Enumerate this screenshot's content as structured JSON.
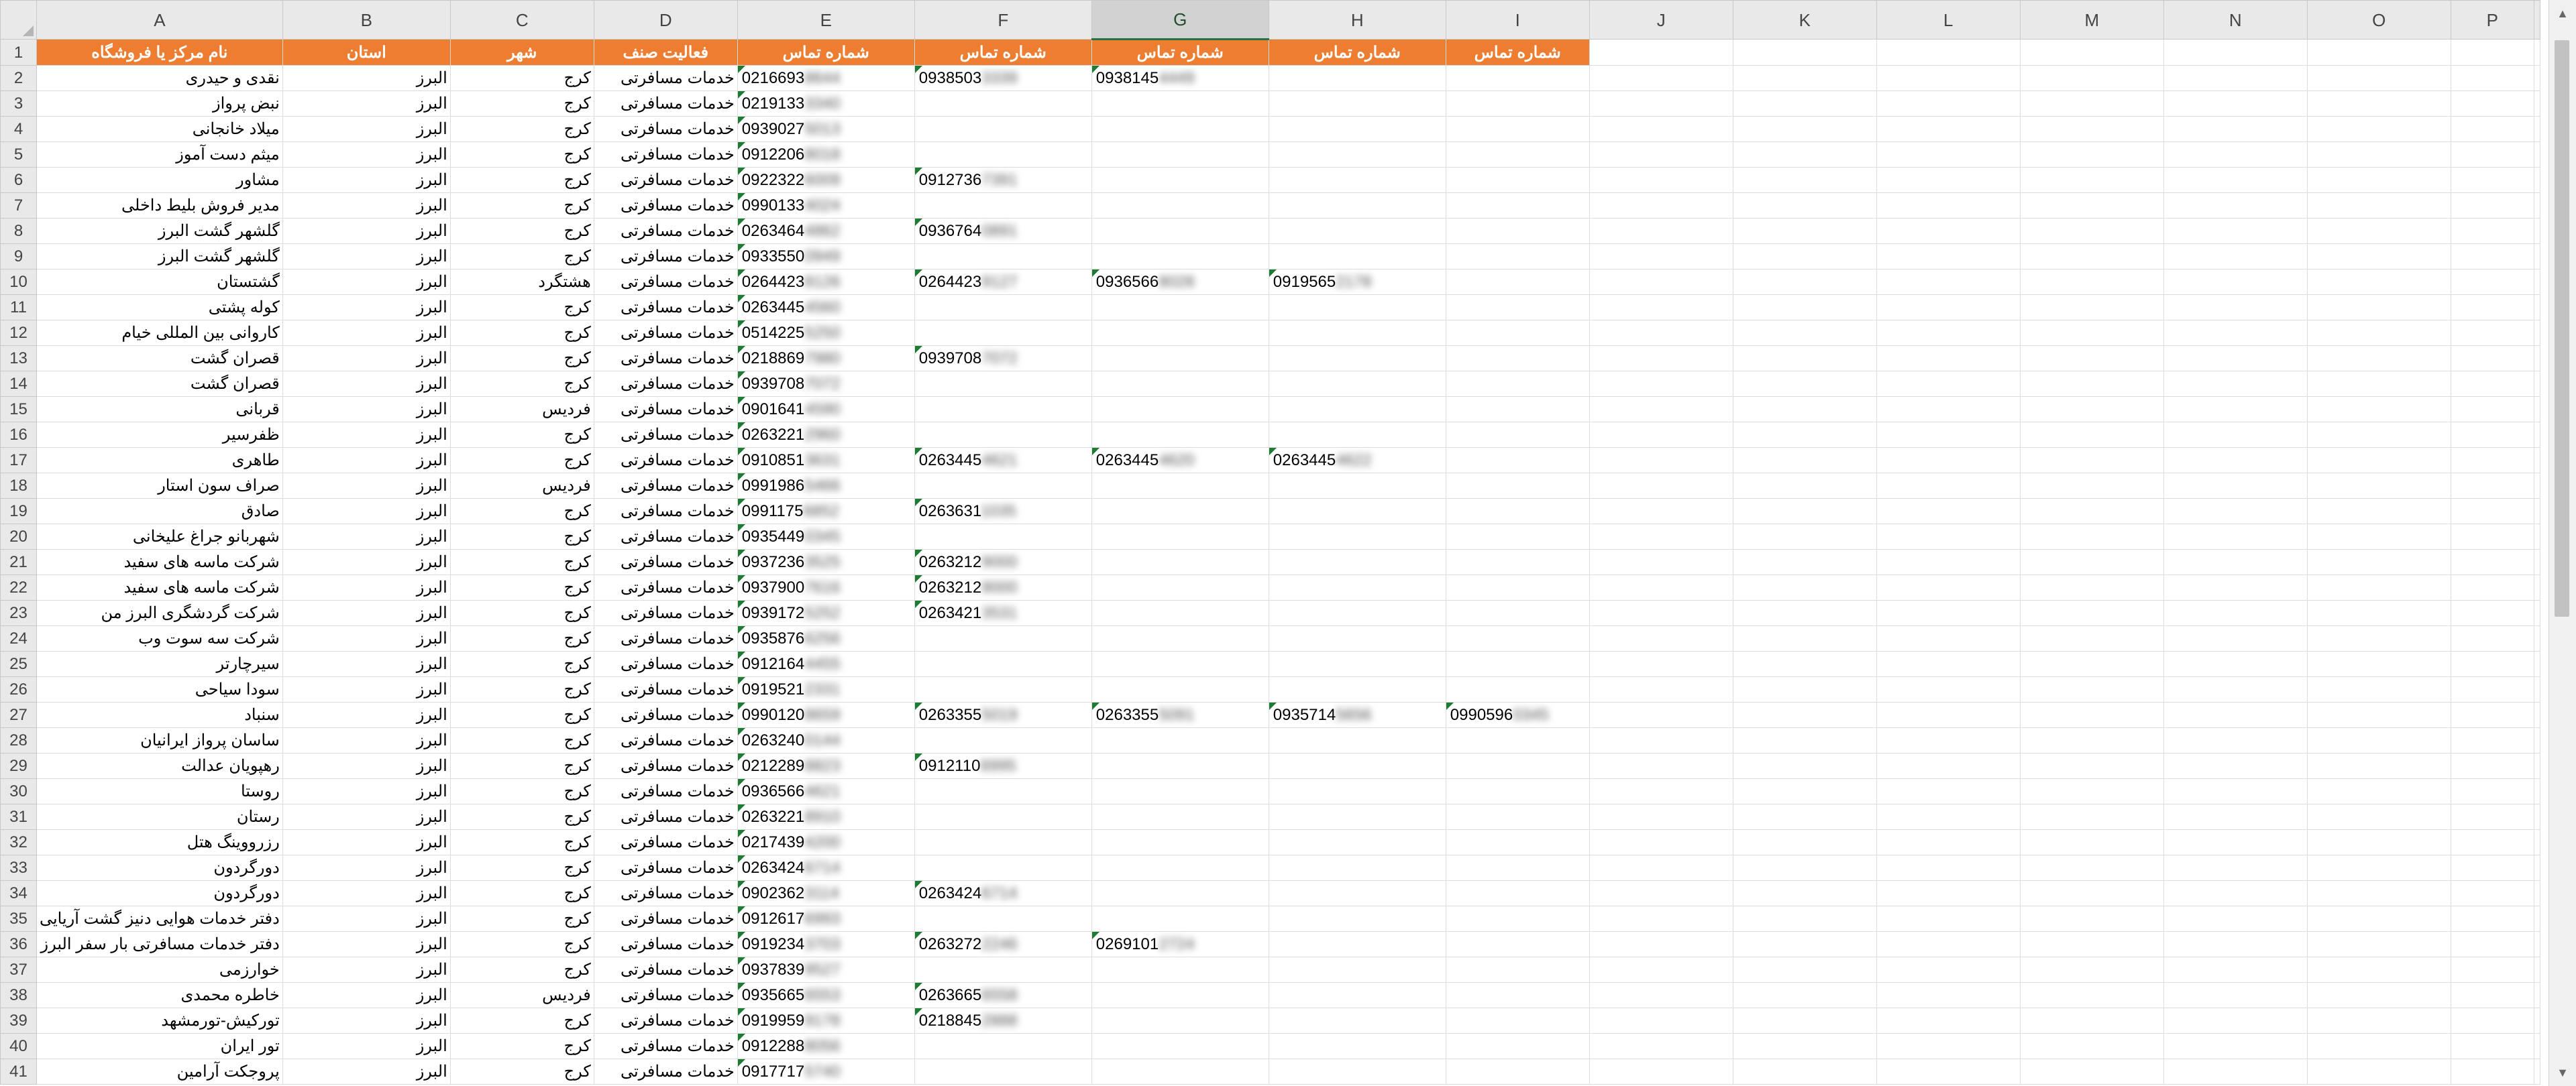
{
  "columns": [
    "A",
    "B",
    "C",
    "D",
    "E",
    "F",
    "G",
    "H",
    "I",
    "J",
    "K",
    "L",
    "M",
    "N",
    "O",
    "P"
  ],
  "selected_column": "G",
  "headers": [
    "نام مرکز یا فروشگاه",
    "استان",
    "شهر",
    "فعالیت صنف",
    "شماره تماس",
    "شماره تماس",
    "شماره تماس",
    "شماره تماس",
    "شماره تماس"
  ],
  "rows": [
    {
      "n": "2",
      "name": "نقدی و حیدری",
      "prov": "البرز",
      "city": "کرج",
      "act": "خدمات مسافرتی",
      "p": [
        [
          "0216693",
          "8644"
        ],
        [
          "0938503",
          "3339"
        ],
        [
          "0938145",
          "4449"
        ],
        null,
        null
      ]
    },
    {
      "n": "3",
      "name": "نبض پرواز",
      "prov": "البرز",
      "city": "کرج",
      "act": "خدمات مسافرتی",
      "p": [
        [
          "0219133",
          "3340"
        ],
        null,
        null,
        null,
        null
      ]
    },
    {
      "n": "4",
      "name": "میلاد خانجانی",
      "prov": "البرز",
      "city": "کرج",
      "act": "خدمات مسافرتی",
      "p": [
        [
          "0939027",
          "5013"
        ],
        null,
        null,
        null,
        null
      ]
    },
    {
      "n": "5",
      "name": "میثم دست آموز",
      "prov": "البرز",
      "city": "کرج",
      "act": "خدمات مسافرتی",
      "p": [
        [
          "0912206",
          "8018"
        ],
        null,
        null,
        null,
        null
      ]
    },
    {
      "n": "6",
      "name": "مشاور",
      "prov": "البرز",
      "city": "کرج",
      "act": "خدمات مسافرتی",
      "p": [
        [
          "0922322",
          "6009"
        ],
        [
          "0912736",
          "7391"
        ],
        null,
        null,
        null
      ]
    },
    {
      "n": "7",
      "name": "مدیر فروش بلیط داخلی",
      "prov": "البرز",
      "city": "کرج",
      "act": "خدمات مسافرتی",
      "p": [
        [
          "0990133",
          "4024"
        ],
        null,
        null,
        null,
        null
      ]
    },
    {
      "n": "8",
      "name": "گلشهر گشت البرز",
      "prov": "البرز",
      "city": "کرج",
      "act": "خدمات مسافرتی",
      "p": [
        [
          "0263464",
          "4862"
        ],
        [
          "0936764",
          "0891"
        ],
        null,
        null,
        null
      ]
    },
    {
      "n": "9",
      "name": "گلشهر گشت البرز",
      "prov": "البرز",
      "city": "کرج",
      "act": "خدمات مسافرتی",
      "p": [
        [
          "0933550",
          "0949"
        ],
        null,
        null,
        null,
        null
      ]
    },
    {
      "n": "10",
      "name": "گشتستان",
      "prov": "البرز",
      "city": "هشتگرد",
      "act": "خدمات مسافرتی",
      "p": [
        [
          "0264423",
          "8126"
        ],
        [
          "0264423",
          "9127"
        ],
        [
          "0936566",
          "8028"
        ],
        [
          "0919565",
          "2178"
        ],
        null
      ]
    },
    {
      "n": "11",
      "name": "کوله پشتی",
      "prov": "البرز",
      "city": "کرج",
      "act": "خدمات مسافرتی",
      "p": [
        [
          "0263445",
          "4560"
        ],
        null,
        null,
        null,
        null
      ]
    },
    {
      "n": "12",
      "name": "کاروانی بین المللی خیام",
      "prov": "البرز",
      "city": "کرج",
      "act": "خدمات مسافرتی",
      "p": [
        [
          "0514225",
          "5250"
        ],
        null,
        null,
        null,
        null
      ]
    },
    {
      "n": "13",
      "name": "قصران گشت",
      "prov": "البرز",
      "city": "کرج",
      "act": "خدمات مسافرتی",
      "p": [
        [
          "0218869",
          "7980"
        ],
        [
          "0939708",
          "7072"
        ],
        null,
        null,
        null
      ]
    },
    {
      "n": "14",
      "name": "قصران گشت",
      "prov": "البرز",
      "city": "کرج",
      "act": "خدمات مسافرتی",
      "p": [
        [
          "0939708",
          "7072"
        ],
        null,
        null,
        null,
        null
      ]
    },
    {
      "n": "15",
      "name": "قربانی",
      "prov": "البرز",
      "city": "فردیس",
      "act": "خدمات مسافرتی",
      "p": [
        [
          "0901641",
          "4590"
        ],
        null,
        null,
        null,
        null
      ]
    },
    {
      "n": "16",
      "name": "ظفرسیر",
      "prov": "البرز",
      "city": "کرج",
      "act": "خدمات مسافرتی",
      "p": [
        [
          "0263221",
          "2960"
        ],
        null,
        null,
        null,
        null
      ]
    },
    {
      "n": "17",
      "name": "طاهری",
      "prov": "البرز",
      "city": "کرج",
      "act": "خدمات مسافرتی",
      "p": [
        [
          "0910851",
          "3631"
        ],
        [
          "0263445",
          "4621"
        ],
        [
          "0263445",
          "4620"
        ],
        [
          "0263445",
          "4622"
        ],
        null
      ]
    },
    {
      "n": "18",
      "name": "صراف سون استار",
      "prov": "البرز",
      "city": "فردیس",
      "act": "خدمات مسافرتی",
      "p": [
        [
          "0991986",
          "5466"
        ],
        null,
        null,
        null,
        null
      ]
    },
    {
      "n": "19",
      "name": "صادق",
      "prov": "البرز",
      "city": "کرج",
      "act": "خدمات مسافرتی",
      "p": [
        [
          "0991175",
          "6852"
        ],
        [
          "0263631",
          "1035"
        ],
        null,
        null,
        null
      ]
    },
    {
      "n": "20",
      "name": "شهربانو جراغ علیخانی",
      "prov": "البرز",
      "city": "کرج",
      "act": "خدمات مسافرتی",
      "p": [
        [
          "0935449",
          "0345"
        ],
        null,
        null,
        null,
        null
      ]
    },
    {
      "n": "21",
      "name": "شرکت ماسه های سفید",
      "prov": "البرز",
      "city": "کرج",
      "act": "خدمات مسافرتی",
      "p": [
        [
          "0937236",
          "3525"
        ],
        [
          "0263212",
          "9000"
        ],
        null,
        null,
        null
      ]
    },
    {
      "n": "22",
      "name": "شرکت ماسه های سفید",
      "prov": "البرز",
      "city": "کرج",
      "act": "خدمات مسافرتی",
      "p": [
        [
          "0937900",
          "7616"
        ],
        [
          "0263212",
          "9000"
        ],
        null,
        null,
        null
      ]
    },
    {
      "n": "23",
      "name": "شرکت گردشگری البرز من",
      "prov": "البرز",
      "city": "کرج",
      "act": "خدمات مسافرتی",
      "p": [
        [
          "0939172",
          "5252"
        ],
        [
          "0263421",
          "3531"
        ],
        null,
        null,
        null
      ]
    },
    {
      "n": "24",
      "name": "شرکت سه سوت وب",
      "prov": "البرز",
      "city": "کرج",
      "act": "خدمات مسافرتی",
      "p": [
        [
          "0935876",
          "6256"
        ],
        null,
        null,
        null,
        null
      ]
    },
    {
      "n": "25",
      "name": "سیرچارتر",
      "prov": "البرز",
      "city": "کرج",
      "act": "خدمات مسافرتی",
      "p": [
        [
          "0912164",
          "4455"
        ],
        null,
        null,
        null,
        null
      ]
    },
    {
      "n": "26",
      "name": "سودا سیاحی",
      "prov": "البرز",
      "city": "کرج",
      "act": "خدمات مسافرتی",
      "p": [
        [
          "0919521",
          "2331"
        ],
        null,
        null,
        null,
        null
      ]
    },
    {
      "n": "27",
      "name": "سنباد",
      "prov": "البرز",
      "city": "کرج",
      "act": "خدمات مسافرتی",
      "p": [
        [
          "0990120",
          "8659"
        ],
        [
          "0263355",
          "5019"
        ],
        [
          "0263355",
          "5091"
        ],
        [
          "0935714",
          "5656"
        ],
        [
          "0990596",
          "0345"
        ]
      ]
    },
    {
      "n": "28",
      "name": "ساسان پرواز ایرانیان",
      "prov": "البرز",
      "city": "کرج",
      "act": "خدمات مسافرتی",
      "p": [
        [
          "0263240",
          "0144"
        ],
        null,
        null,
        null,
        null
      ]
    },
    {
      "n": "29",
      "name": "رهپویان عدالت",
      "prov": "البرز",
      "city": "کرج",
      "act": "خدمات مسافرتی",
      "p": [
        [
          "0212289",
          "8823"
        ],
        [
          "0912110",
          "6995"
        ],
        null,
        null,
        null
      ]
    },
    {
      "n": "30",
      "name": "روستا",
      "prov": "البرز",
      "city": "کرج",
      "act": "خدمات مسافرتی",
      "p": [
        [
          "0936566",
          "4621"
        ],
        null,
        null,
        null,
        null
      ]
    },
    {
      "n": "31",
      "name": "رستان",
      "prov": "البرز",
      "city": "کرج",
      "act": "خدمات مسافرتی",
      "p": [
        [
          "0263221",
          "8910"
        ],
        null,
        null,
        null,
        null
      ]
    },
    {
      "n": "32",
      "name": "رزرووینگ هتل",
      "prov": "البرز",
      "city": "کرج",
      "act": "خدمات مسافرتی",
      "p": [
        [
          "0217439",
          "4200"
        ],
        null,
        null,
        null,
        null
      ]
    },
    {
      "n": "33",
      "name": "دورگردون",
      "prov": "البرز",
      "city": "کرج",
      "act": "خدمات مسافرتی",
      "p": [
        [
          "0263424",
          "6714"
        ],
        null,
        null,
        null,
        null
      ]
    },
    {
      "n": "34",
      "name": "دورگردون",
      "prov": "البرز",
      "city": "کرج",
      "act": "خدمات مسافرتی",
      "p": [
        [
          "0902362",
          "3114"
        ],
        [
          "0263424",
          "6714"
        ],
        null,
        null,
        null
      ]
    },
    {
      "n": "35",
      "name": "دفتر خدمات هوایی دنیز گشت آریایی",
      "prov": "البرز",
      "city": "کرج",
      "act": "خدمات مسافرتی",
      "p": [
        [
          "0912617",
          "6993"
        ],
        null,
        null,
        null,
        null
      ]
    },
    {
      "n": "36",
      "name": "دفتر خدمات مسافرتی بار سفر البرز",
      "prov": "البرز",
      "city": "کرج",
      "act": "خدمات مسافرتی",
      "p": [
        [
          "0919234",
          "3703"
        ],
        [
          "0263272",
          "2246"
        ],
        [
          "0269101",
          "2724"
        ],
        null,
        null
      ]
    },
    {
      "n": "37",
      "name": "خوارزمی",
      "prov": "البرز",
      "city": "کرج",
      "act": "خدمات مسافرتی",
      "p": [
        [
          "0937839",
          "9527"
        ],
        null,
        null,
        null,
        null
      ]
    },
    {
      "n": "38",
      "name": "خاطره محمدی",
      "prov": "البرز",
      "city": "فردیس",
      "act": "خدمات مسافرتی",
      "p": [
        [
          "0935665",
          "6553"
        ],
        [
          "0263665",
          "6558"
        ],
        null,
        null,
        null
      ]
    },
    {
      "n": "39",
      "name": "تورکیش-تورمشهد",
      "prov": "البرز",
      "city": "کرج",
      "act": "خدمات مسافرتی",
      "p": [
        [
          "0919959",
          "9178"
        ],
        [
          "0218845",
          "2888"
        ],
        null,
        null,
        null
      ]
    },
    {
      "n": "40",
      "name": "تور ایران",
      "prov": "البرز",
      "city": "کرج",
      "act": "خدمات مسافرتی",
      "p": [
        [
          "0912288",
          "8056"
        ],
        null,
        null,
        null,
        null
      ]
    },
    {
      "n": "41",
      "name": "پروجکت آرامین",
      "prov": "البرز",
      "city": "کرج",
      "act": "خدمات مسافرتی",
      "p": [
        [
          "0917717",
          "5740"
        ],
        null,
        null,
        null,
        null
      ]
    }
  ]
}
